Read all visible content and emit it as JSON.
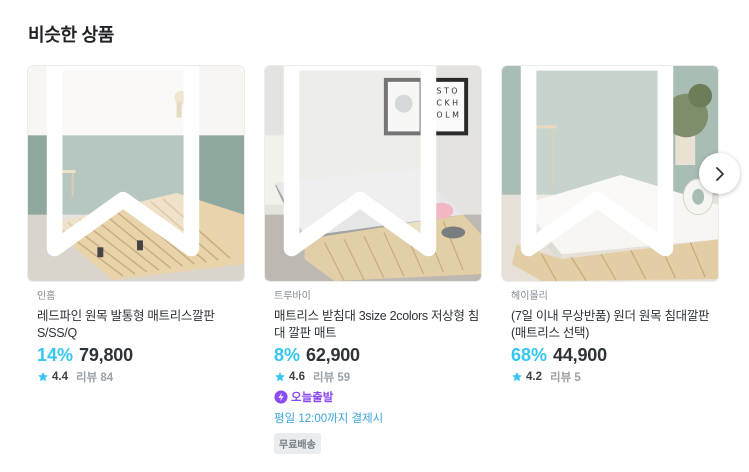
{
  "section": {
    "title": "비슷한 상품"
  },
  "products": [
    {
      "brand": "인홈",
      "name": "레드파인 원목 발통형 매트리스깔판 S/SS/Q",
      "discount": "14%",
      "price": "79,800",
      "rating": "4.4",
      "review_label": "리뷰 84",
      "icon": "bookmark-icon"
    },
    {
      "brand": "트루바이",
      "name": "매트리스 받침대 3size 2colors 저상형 침대 깔판 매트",
      "discount": "8%",
      "price": "62,900",
      "rating": "4.6",
      "review_label": "리뷰 59",
      "departure": "오늘출발",
      "deadline": "평일 12:00까지 결제시",
      "badge": "무료배송",
      "icon": "bookmark-icon"
    },
    {
      "brand": "헤이몰리",
      "name": "(7일 이내 무상반품) 원더 원목 침대깔판 (매트리스 선택)",
      "discount": "68%",
      "price": "44,900",
      "rating": "4.2",
      "review_label": "리뷰 5",
      "icon": "bookmark-icon"
    }
  ],
  "colors": {
    "accent": "#35c5f0",
    "departure": "#8a4bf0",
    "star": "#35c5f0"
  },
  "next_button": {
    "icon": "chevron-right-icon"
  }
}
